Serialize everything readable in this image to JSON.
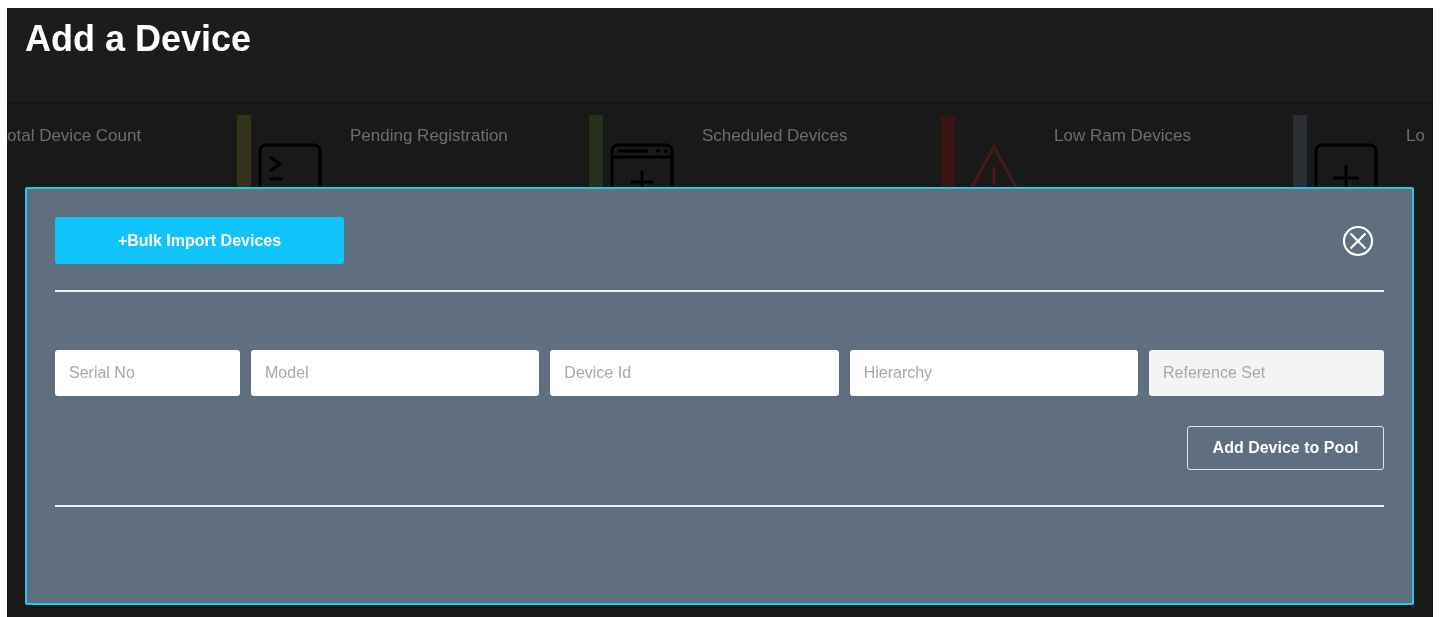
{
  "page_title": "Add a Device",
  "stat_cards": [
    {
      "label": "otal Device Count"
    },
    {
      "label": "Pending Registration",
      "color": "#33331a",
      "kind": "terminal"
    },
    {
      "label": "Scheduled Devices",
      "color": "#26301a",
      "kind": "window"
    },
    {
      "label": "Low Ram Devices",
      "color": "#3a1412",
      "kind": "warning"
    },
    {
      "label": "Lo",
      "color": "#2a2d31",
      "kind": "plus"
    }
  ],
  "modal": {
    "bulk_import_button": "+Bulk Import Devices",
    "fields": [
      {
        "placeholder": "Serial No",
        "disabled": false
      },
      {
        "placeholder": "Model",
        "disabled": false
      },
      {
        "placeholder": "Device Id",
        "disabled": false
      },
      {
        "placeholder": "Hierarchy",
        "disabled": false
      },
      {
        "placeholder": "Reference Set",
        "disabled": true
      }
    ],
    "add_button": "Add Device to Pool"
  }
}
